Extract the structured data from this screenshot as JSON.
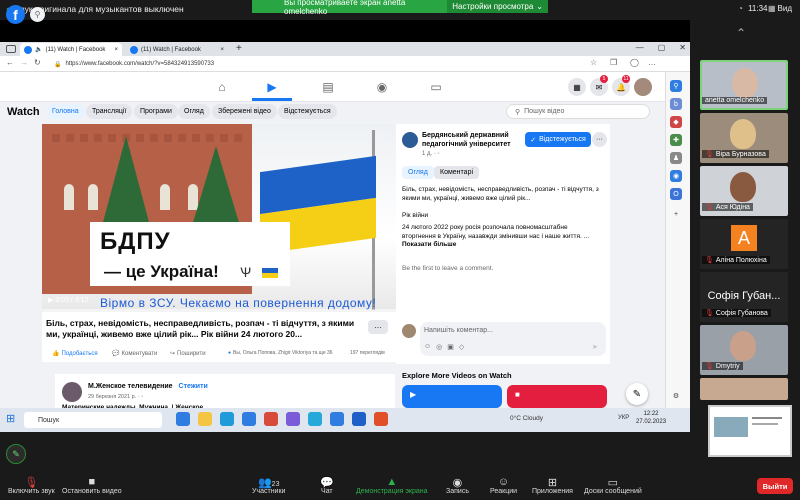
{
  "zoom_top": {
    "original_sound_notice": "Звук оригинала для музыкантов выключен",
    "viewing_banner": "Вы просматриваете экран anetta omelchenko",
    "view_settings": "Настройки просмотра",
    "clock": "11:34",
    "view_label": "Вид"
  },
  "browser": {
    "tabs": [
      {
        "label": "(11) Watch | Facebook"
      },
      {
        "label": "(11) Watch | Facebook"
      }
    ],
    "new_tab": "+",
    "url": "https://www.facebook.com/watch/?v=584324913590733"
  },
  "facebook": {
    "logo": "f",
    "notif_messenger": "5",
    "notif_bell": "11",
    "watch_title": "Watch",
    "nav_pills": [
      "Головна",
      "Трансляції",
      "Програми",
      "Огляд",
      "Збережені відео",
      "Відстежується"
    ],
    "search_placeholder": "Пошук відео",
    "video": {
      "banner_line1": "БДПУ",
      "banner_line2": "— це Україна!",
      "subtitle": "Вірмо в ЗСУ. Чекаємо на повернення додому!",
      "time": "0:03 / 3:12"
    },
    "caption": "Біль, страх, невідомість, несправедливість, розпач - ті відчуття, з якими ми, українці, живемо вже цілий рік... Рік війни 24 лютого 20...",
    "caption_more": "···",
    "actions": {
      "like": "Подобається",
      "comment": "Коментувати",
      "share": "Поширити",
      "reactions": "Вы, Ольга Попова, Zhigir Viktoriya та ще 36",
      "views": "197 переглядів"
    },
    "side": {
      "channel_name": "Бердянський державний педагогічний університет",
      "channel_meta": "1 д. · ◦",
      "follow": "Відстежується",
      "more": "···",
      "tab_overview": "Огляд",
      "tab_comments": "Коментарі",
      "desc1": "Біль, страх, невідомість, несправедливість, розпач - ті відчуття, з якими ми, українці, живемо вже цілий рік...",
      "desc2": "Рік війни",
      "desc3": "24 лютого 2022 року росія розпочала повномасштабне вторгнення в Україну, назавжди змінивши нас і наше життя. ...",
      "show_more": "Показати більше",
      "first_comment": "Be the first to leave a comment.",
      "comment_placeholder": "Напишіть коментар...",
      "explore": "Explore More Videos on Watch"
    },
    "post2": {
      "author": "М.Женское телевидение",
      "follow": "Стежити",
      "date": "29 березня 2021 р. · ◦",
      "text": "Материнские надежды. Мужчина. | Женское..."
    }
  },
  "taskbar": {
    "search": "Пошук",
    "weather": "0°C  Cloudy",
    "lang": "УКР",
    "time": "12:22",
    "date": "27.02.2023"
  },
  "gallery": {
    "participants": [
      {
        "name": "anetta omelchenko",
        "muted": false
      },
      {
        "name": "Віра Бурназова",
        "muted": true
      },
      {
        "name": "Ася Юдіна",
        "muted": true
      },
      {
        "name": "Аліна Полюхіна",
        "muted": true,
        "avatar_letter": "A"
      },
      {
        "name": "Софія Губанова",
        "muted": true,
        "big_text": "Софія  Губан..."
      },
      {
        "name": "Dmytriy",
        "muted": true
      }
    ]
  },
  "zoom_bottom": {
    "mute": "Включить звук",
    "video": "Остановить видео",
    "participants": "Участники",
    "participants_count": "23",
    "chat": "Чат",
    "share": "Демонстрация экрана",
    "record": "Запись",
    "reactions": "Реакции",
    "apps": "Приложения",
    "whiteboards": "Доски сообщений",
    "leave": "Выйти"
  },
  "colors": {
    "fb_blue": "#1877f2",
    "zoom_green": "#29a643",
    "leave_red": "#e02828"
  }
}
